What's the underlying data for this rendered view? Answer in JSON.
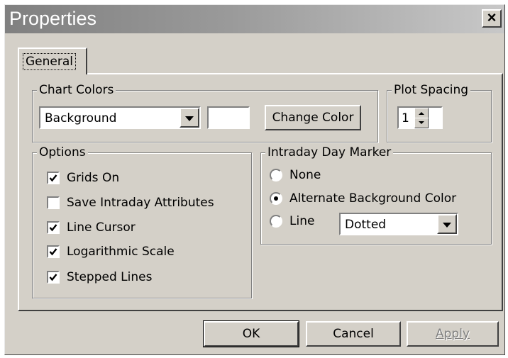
{
  "window": {
    "title": "Properties"
  },
  "tabs": [
    {
      "label": "General"
    }
  ],
  "chart_colors": {
    "legend": "Chart Colors",
    "element_select": {
      "value": "Background"
    },
    "swatch_color": "#ffffff",
    "change_color_label": "Change Color"
  },
  "plot_spacing": {
    "legend": "Plot Spacing",
    "value": "1"
  },
  "options": {
    "legend": "Options",
    "items": [
      {
        "label": "Grids On",
        "checked": true
      },
      {
        "label": "Save Intraday Attributes",
        "checked": false
      },
      {
        "label": "Line Cursor",
        "checked": true
      },
      {
        "label": "Logarithmic Scale",
        "checked": true
      },
      {
        "label": "Stepped Lines",
        "checked": true
      }
    ]
  },
  "intraday_marker": {
    "legend": "Intraday Day Marker",
    "choices": [
      {
        "label": "None",
        "selected": false
      },
      {
        "label": "Alternate Background Color",
        "selected": true
      },
      {
        "label": "Line",
        "selected": false
      }
    ],
    "line_style": {
      "value": "Dotted"
    }
  },
  "buttons": {
    "ok": "OK",
    "cancel": "Cancel",
    "apply": "Apply"
  },
  "icons": {
    "close": "close-icon",
    "dropdown": "chevron-down-icon",
    "spin_up": "arrow-up-icon",
    "spin_down": "arrow-down-icon"
  }
}
